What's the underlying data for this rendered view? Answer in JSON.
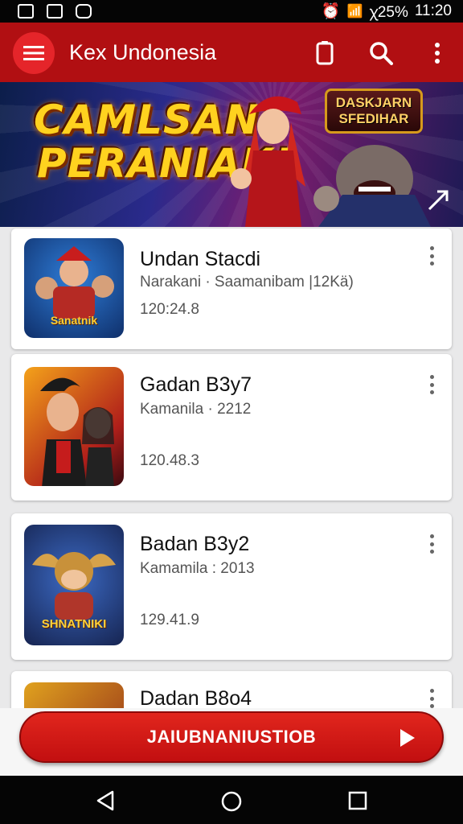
{
  "status_bar": {
    "right_text": "ꭓ25%",
    "time": "11:20"
  },
  "app_bar": {
    "title": "Kex Undonesia",
    "icons": [
      "menu-icon",
      "phone-icon",
      "search-icon",
      "more-vert-icon"
    ]
  },
  "banner": {
    "headline_line1": "CAMLSAN!",
    "headline_line2": "PERANIAK!",
    "badge_line1": "DASKJARN",
    "badge_line2": "SFEDIHAR"
  },
  "items": [
    {
      "title": "Undan Stacdi",
      "subtitle": "Narakani · Saamanibam |12Kä)",
      "value": "120:24.8",
      "thumb_text": "Sanatnik"
    },
    {
      "title": "Gadan B3y7",
      "subtitle": "Kamanila · 2212",
      "value": "120.48.3",
      "thumb_text": ""
    },
    {
      "title": "Badan B3y2",
      "subtitle": "Kamamila : 2013",
      "value": "129.41.9",
      "thumb_text": "SHNATNIKI"
    },
    {
      "title": "Dadan B8o4",
      "subtitle": "",
      "value": "",
      "thumb_text": ""
    }
  ],
  "cta": {
    "label": "JAIUBNANIUSTIOB"
  },
  "colors": {
    "app_bar": "#b10f12",
    "accent": "#e5252a",
    "cta": "#d0161a"
  }
}
